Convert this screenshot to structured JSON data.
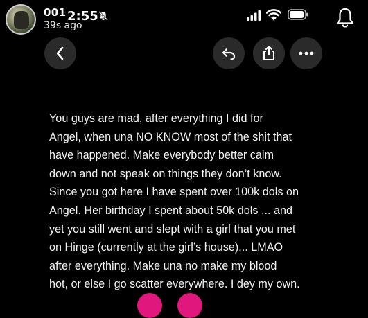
{
  "header": {
    "username": "001",
    "time_ago": "39s ago",
    "status_bar": {
      "clock": "2:55"
    }
  },
  "icons": {
    "back": "chevron-left-icon",
    "reply": "reply-arrow-icon",
    "share": "share-icon",
    "more": "more-horizontal-icon",
    "notifications": "bell-icon",
    "mute": "bell-slash-icon",
    "signal": "cellular-signal-icon",
    "wifi": "wifi-icon",
    "battery": "battery-icon"
  },
  "story": {
    "text": "You guys are mad, after everything I did for\nAngel, when una NO KNOW most of the shit that\nhave happened. Make everybody better calm\ndown and not speak on things they don’t know.\nSince you got here I have spent over 100k dols  on\nAngel. Her birthday I spent about 50k dols ...  and\nyet you still went and slept with a girl that you met\non Hinge (currently at the girl’s house)...  LMAO\nafter everything. Make una no make my blood\nhot, or else I go scatter everywhere. I dey my own."
  },
  "colors": {
    "background": "#000000",
    "button_bg": "#2a2a2a",
    "reaction_accent": "#e0177d",
    "text": "#f2f2f2"
  }
}
